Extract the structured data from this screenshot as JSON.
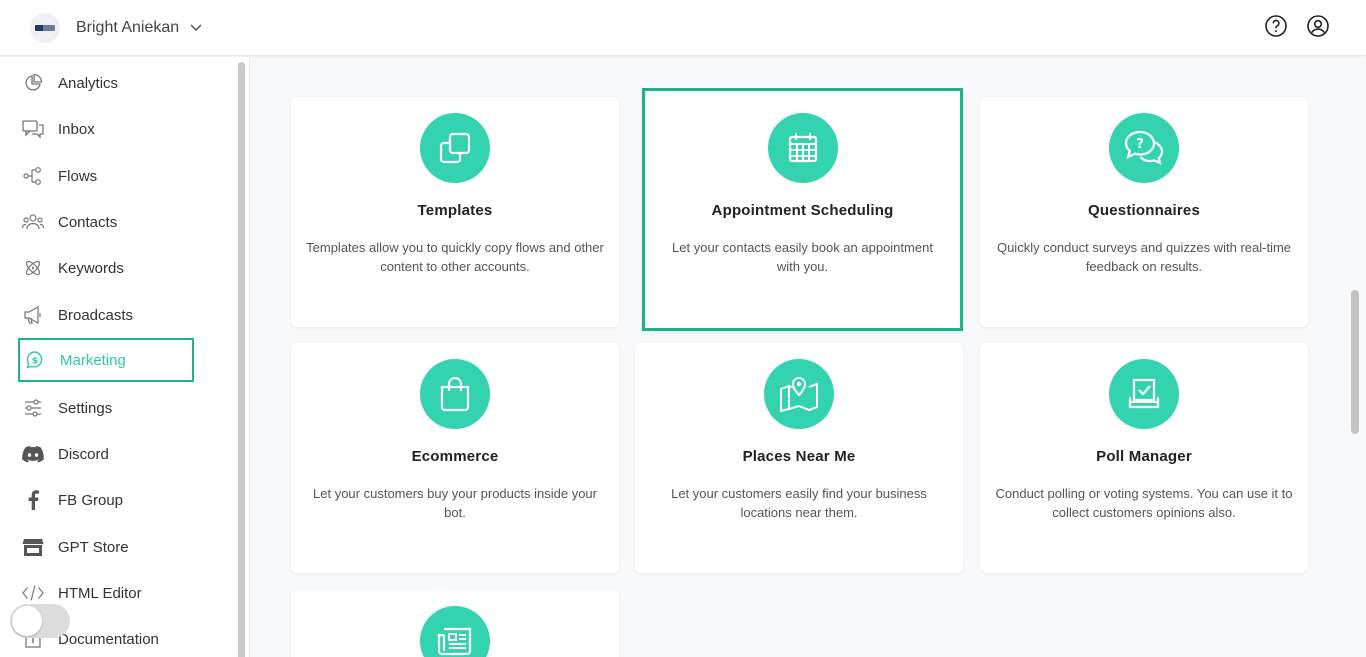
{
  "header": {
    "account_name": "Bright Aniekan",
    "icons": [
      "help-circle-icon",
      "user-circle-icon"
    ]
  },
  "sidebar": {
    "items": [
      {
        "label": "Analytics",
        "icon": "pie-chart-icon"
      },
      {
        "label": "Inbox",
        "icon": "chat-bubbles-icon"
      },
      {
        "label": "Flows",
        "icon": "flow-nodes-icon"
      },
      {
        "label": "Contacts",
        "icon": "users-icon"
      },
      {
        "label": "Keywords",
        "icon": "atom-icon"
      },
      {
        "label": "Broadcasts",
        "icon": "megaphone-icon"
      },
      {
        "label": "Marketing",
        "icon": "dollar-chat-icon",
        "active": true
      },
      {
        "label": "Settings",
        "icon": "sliders-icon"
      },
      {
        "label": "Discord",
        "icon": "discord-icon"
      },
      {
        "label": "FB Group",
        "icon": "facebook-icon"
      },
      {
        "label": "GPT Store",
        "icon": "store-icon"
      },
      {
        "label": "HTML Editor",
        "icon": "code-icon"
      },
      {
        "label": "Documentation",
        "icon": "document-icon"
      }
    ]
  },
  "cards": [
    {
      "title": "Templates",
      "desc": "Templates allow you to quickly copy flows and other content to other accounts.",
      "icon": "copy-icon"
    },
    {
      "title": "Appointment Scheduling",
      "desc": "Let your contacts easily book an appointment with you.",
      "icon": "calendar-icon"
    },
    {
      "title": "Questionnaires",
      "desc": "Quickly conduct surveys and quizzes with real-time feedback on results.",
      "icon": "question-chat-icon"
    },
    {
      "title": "Ecommerce",
      "desc": "Let your customers buy your products inside your bot.",
      "icon": "shopping-bag-icon"
    },
    {
      "title": "Places Near Me",
      "desc": "Let your customers easily find your business locations near them.",
      "icon": "map-pin-icon"
    },
    {
      "title": "Poll Manager",
      "desc": "Conduct polling or voting systems. You can use it to collect customers opinions also.",
      "icon": "ballot-box-icon"
    },
    {
      "title": "",
      "desc": "",
      "icon": "newspaper-icon"
    }
  ],
  "colors": {
    "accent": "#34d3b0",
    "highlight_border": "#1eb28a",
    "active_text": "#2ecaa0"
  }
}
